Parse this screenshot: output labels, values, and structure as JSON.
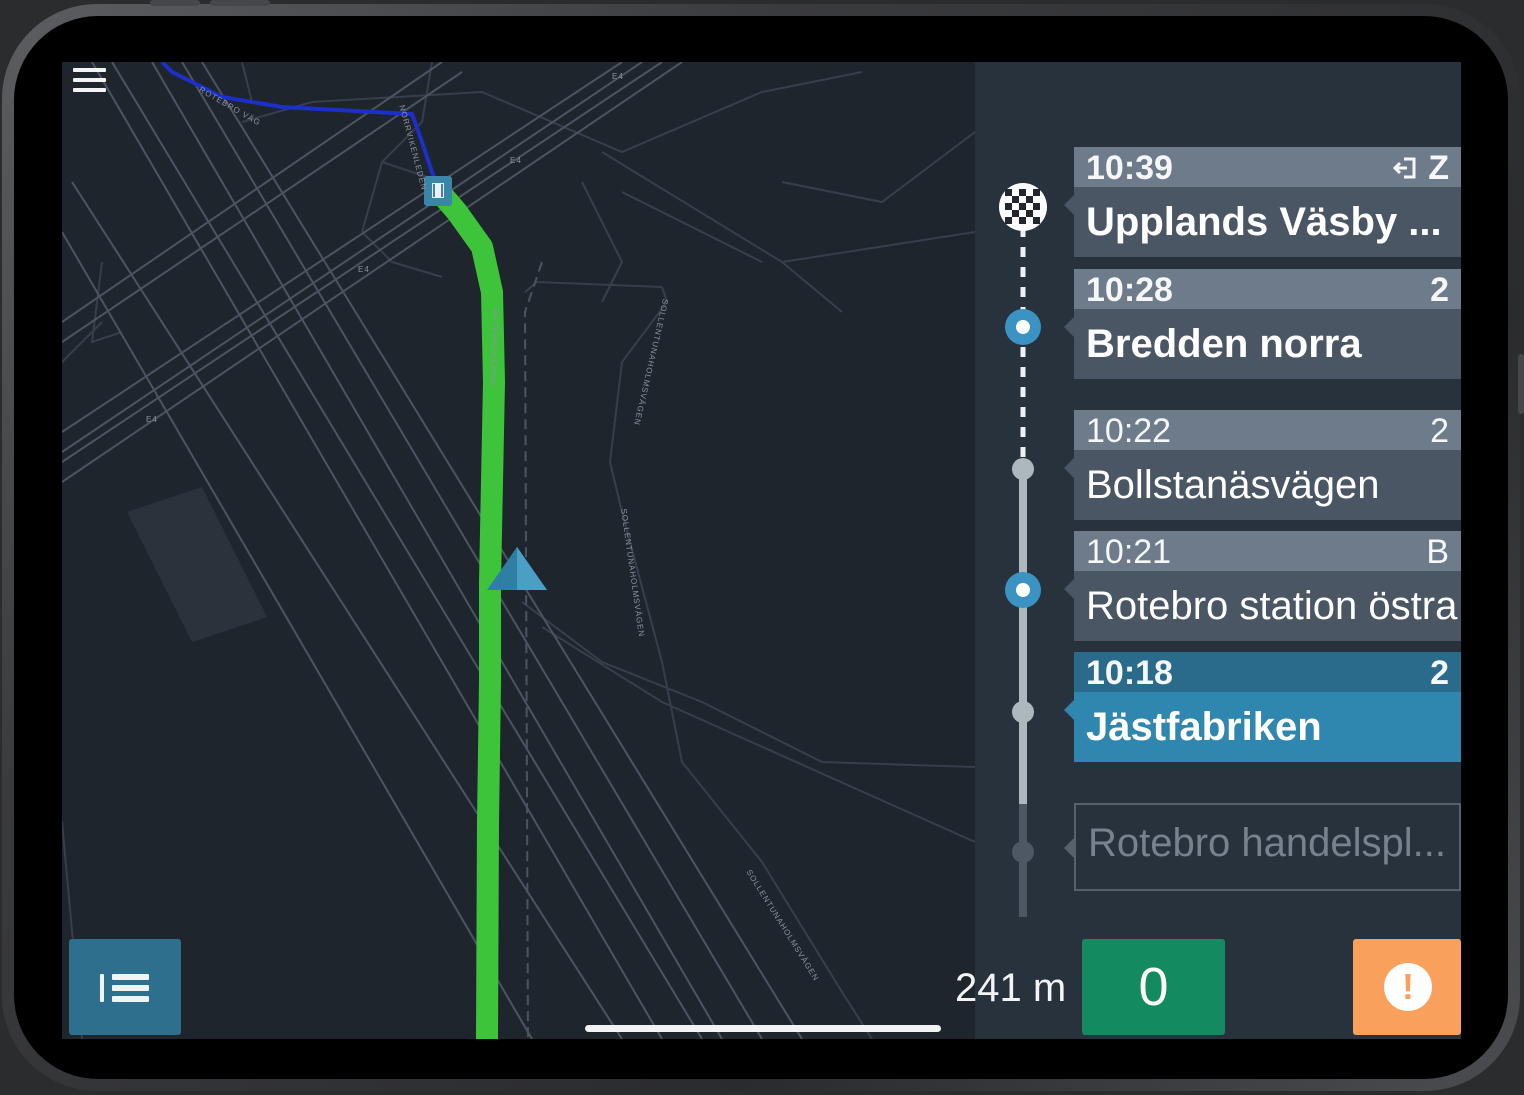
{
  "app": {
    "menu_icon": "hamburger-menu-icon",
    "stop_list_icon": "stop-list-icon",
    "alert_icon": "exclamation-icon",
    "finish_icon": "checkered-flag-icon",
    "exit_icon": "exit-door-icon",
    "bus_stop_icon": "bus-stop-icon",
    "vehicle_icon": "vehicle-position-arrow-icon"
  },
  "map": {
    "road_labels": [
      "ROTEBROLEDEN",
      "SOLLENTUNAHOLMSVÄGEN",
      "SOLLENTUNAHOLMSVÄGEN",
      "SOLLENTUNAHOLMSVÄGEN",
      "E4",
      "E4",
      "E4",
      "E4",
      "NORRVIKENLEDEN",
      "ROTEBRO VÄG"
    ],
    "colors": {
      "route_ahead": "#3ec43a",
      "route_behind": "#1d2fc9",
      "background": "#1f252d"
    }
  },
  "stops": [
    {
      "time": "10:39",
      "zone": "Z",
      "name": "Upplands Väsby ...",
      "state": "final"
    },
    {
      "time": "10:28",
      "zone": "2",
      "name": "Bredden norra",
      "state": "upcoming"
    },
    {
      "time": "10:22",
      "zone": "2",
      "name": "Bollstanäsvägen",
      "state": "upcoming"
    },
    {
      "time": "10:21",
      "zone": "B",
      "name": "Rotebro station östra",
      "state": "upcoming"
    },
    {
      "time": "10:18",
      "zone": "2",
      "name": "Jästfabriken",
      "state": "current"
    },
    {
      "time": "",
      "zone": "",
      "name": "Rotebro handelspl...",
      "state": "passed"
    }
  ],
  "footer": {
    "distance": "241 m",
    "counter": "0"
  },
  "colors": {
    "counter": "#138a5f",
    "alert": "#f9a15c",
    "current_stop": "#2f86ae",
    "list_button": "#2e6f8e"
  }
}
